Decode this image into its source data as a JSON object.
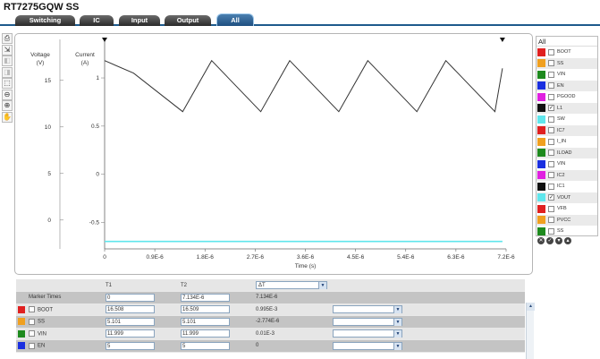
{
  "app": {
    "title": "RT7275GQW SS"
  },
  "tabs": [
    {
      "label": "Switching",
      "active": false
    },
    {
      "label": "IC",
      "active": false
    },
    {
      "label": "Input",
      "active": false
    },
    {
      "label": "Output",
      "active": false
    },
    {
      "label": "All",
      "active": true
    }
  ],
  "toolbar": {
    "tools": [
      {
        "icon": "print-icon",
        "glyph": "⎙",
        "enabled": true
      },
      {
        "icon": "export-icon",
        "glyph": "⇲",
        "enabled": true
      },
      {
        "icon": "pan-left-icon",
        "glyph": "◧",
        "enabled": false
      },
      {
        "icon": "pan-right-icon",
        "glyph": "◨",
        "enabled": false
      },
      {
        "icon": "zoom-box-icon",
        "glyph": "⬚",
        "enabled": true
      },
      {
        "icon": "zoom-out-icon",
        "glyph": "⊖",
        "enabled": true
      },
      {
        "icon": "zoom-in-icon",
        "glyph": "⊕",
        "enabled": true
      },
      {
        "icon": "hand-icon",
        "glyph": "✋",
        "enabled": true
      }
    ]
  },
  "chart_data": {
    "type": "line",
    "xlabel": "Time (s)",
    "x_ticks": [
      "0",
      "0.9E-6",
      "1.8E-6",
      "2.7E-6",
      "3.6E-6",
      "4.5E-6",
      "5.4E-6",
      "6.3E-6",
      "7.2E-6"
    ],
    "xlim": [
      0,
      7.2e-06
    ],
    "y_axes": [
      {
        "label": "Voltage (V)",
        "label_lines": [
          "Voltage",
          "(V)"
        ],
        "ticks": [
          "15",
          "10",
          "5",
          "0"
        ],
        "tick_values": [
          15,
          10,
          5,
          0
        ],
        "ylim": [
          -3.1,
          19.4
        ]
      },
      {
        "label": "Current (A)",
        "label_lines": [
          "Current",
          "(A)"
        ],
        "ticks": [
          "1",
          "0.5",
          "0",
          "-0.5"
        ],
        "tick_values": [
          1,
          0.5,
          0,
          -0.5
        ],
        "ylim": [
          -0.775,
          1.4
        ]
      }
    ],
    "series": [
      {
        "name": "L1",
        "axis": "current",
        "color": "#333333",
        "x": [
          0,
          5.2e-07,
          1.4e-06,
          1.92e-06,
          2.8e-06,
          3.32e-06,
          4.2e-06,
          4.72e-06,
          5.6e-06,
          6.12e-06,
          7e-06,
          7.134e-06
        ],
        "y": [
          1.18,
          1.05,
          0.65,
          1.18,
          0.65,
          1.18,
          0.65,
          1.18,
          0.65,
          1.18,
          0.65,
          1.1
        ]
      },
      {
        "name": "VOUT",
        "axis": "voltage",
        "color": "#5fe6ec",
        "x": [
          0,
          7.134e-06
        ],
        "y": [
          -2.3,
          -2.3
        ]
      }
    ]
  },
  "legend": {
    "header": "All",
    "items": [
      {
        "label": "BOOT",
        "color": "#e02020",
        "checked": false
      },
      {
        "label": "SS",
        "color": "#f0a020",
        "checked": false
      },
      {
        "label": "VIN",
        "color": "#1e8a1e",
        "checked": false
      },
      {
        "label": "EN",
        "color": "#1a2fe0",
        "checked": false
      },
      {
        "label": "PGOOD",
        "color": "#e020e0",
        "checked": false
      },
      {
        "label": "L1",
        "color": "#111111",
        "checked": true
      },
      {
        "label": "SW",
        "color": "#5fe6ec",
        "checked": false
      },
      {
        "label": "IC7",
        "color": "#e02020",
        "checked": false
      },
      {
        "label": "I_IN",
        "color": "#f0a020",
        "checked": false
      },
      {
        "label": "ILOAD",
        "color": "#1e8a1e",
        "checked": false
      },
      {
        "label": "VIN",
        "color": "#1a2fe0",
        "checked": false
      },
      {
        "label": "IC2",
        "color": "#e020e0",
        "checked": false
      },
      {
        "label": "IC1",
        "color": "#111111",
        "checked": false
      },
      {
        "label": "VOUT",
        "color": "#5fe6ec",
        "checked": true
      },
      {
        "label": "VFB",
        "color": "#e02020",
        "checked": false
      },
      {
        "label": "PVCC",
        "color": "#f0a020",
        "checked": false
      },
      {
        "label": "SS",
        "color": "#1e8a1e",
        "checked": false
      }
    ],
    "controls": [
      {
        "icon": "close-circle-icon",
        "glyph": "✕"
      },
      {
        "icon": "check-circle-icon",
        "glyph": "✓"
      },
      {
        "icon": "down-circle-icon",
        "glyph": "▾"
      },
      {
        "icon": "up-circle-icon",
        "glyph": "▴"
      }
    ]
  },
  "markers": {
    "headers": {
      "t1": "T1",
      "t2": "T2",
      "delta": "ΔT"
    },
    "marker_row": {
      "label": "Marker Times",
      "t1": "0",
      "t2": "7.134E-6",
      "delta": "7.134E-6"
    },
    "rows": [
      {
        "label": "BOOT",
        "color": "#e02020",
        "t1": "16.508",
        "t2": "16.509",
        "delta": "0.995E-3"
      },
      {
        "label": "SS",
        "color": "#f0a020",
        "t1": "5.101",
        "t2": "5.101",
        "delta": "-2.774E-6"
      },
      {
        "label": "VIN",
        "color": "#1e8a1e",
        "t1": "11.999",
        "t2": "11.999",
        "delta": "0.01E-3"
      },
      {
        "label": "EN",
        "color": "#1a2fe0",
        "t1": "5",
        "t2": "5",
        "delta": "0"
      }
    ]
  }
}
